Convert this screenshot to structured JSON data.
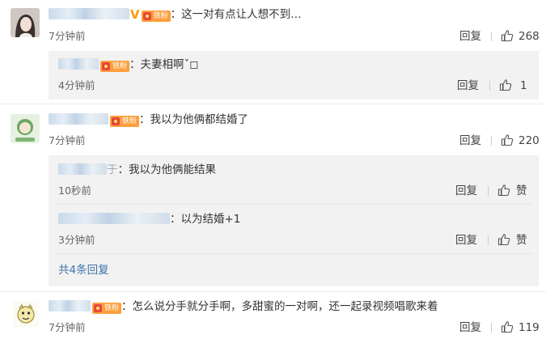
{
  "comments": [
    {
      "badge": "铁粉",
      "text": "这一对有点让人想不到…",
      "time": "7分钟前",
      "reply_label": "回复",
      "likes": "268",
      "avatar_icon": "girl-photo-avatar",
      "replies": [
        {
          "badge": "铁粉",
          "text": "夫妻相啊ˇ◻",
          "time": "4分钟前",
          "reply_label": "回复",
          "likes": "1"
        }
      ]
    },
    {
      "badge": "铁粉",
      "text": "我以为他俩都结婚了",
      "time": "7分钟前",
      "reply_label": "回复",
      "likes": "220",
      "avatar_icon": "green-character-avatar",
      "replies": [
        {
          "name_suffix": "于",
          "text": "我以为他俩能结果",
          "time": "10秒前",
          "reply_label": "回复",
          "like_label": "赞"
        },
        {
          "text": "以为结婚+1",
          "time": "3分钟前",
          "reply_label": "回复",
          "like_label": "赞"
        }
      ],
      "more_replies": "共4条回复"
    },
    {
      "badge": "铁粉",
      "text": "怎么说分手就分手啊，多甜蜜的一对啊，还一起录视频唱歌来着",
      "time": "7分钟前",
      "reply_label": "回复",
      "likes": "119",
      "avatar_icon": "cartoon-face-avatar"
    }
  ],
  "colors": {
    "link": "#3d74ae",
    "fan_badge": "#fd9f3e",
    "vip_v": "#ff9a00",
    "reply_bg": "#f2f2f2"
  }
}
